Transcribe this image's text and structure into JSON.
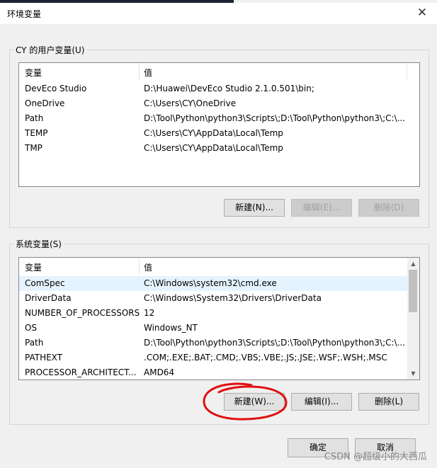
{
  "window": {
    "title": "环境变量",
    "close_glyph": "✕"
  },
  "user_vars": {
    "group_title": "CY 的用户变量(U)",
    "columns": [
      "变量",
      "值"
    ],
    "rows": [
      {
        "name": "DevEco Studio",
        "value": "D:\\Huawei\\DevEco Studio 2.1.0.501\\bin;"
      },
      {
        "name": "OneDrive",
        "value": "C:\\Users\\CY\\OneDrive"
      },
      {
        "name": "Path",
        "value": "D:\\Tool\\Python\\python3\\Scripts\\;D:\\Tool\\Python\\python3\\;C:\\..."
      },
      {
        "name": "TEMP",
        "value": "C:\\Users\\CY\\AppData\\Local\\Temp"
      },
      {
        "name": "TMP",
        "value": "C:\\Users\\CY\\AppData\\Local\\Temp"
      }
    ],
    "buttons": {
      "new": "新建(N)...",
      "edit": "编辑(E)...",
      "delete": "删除(D)"
    }
  },
  "system_vars": {
    "group_title": "系统变量(S)",
    "columns": [
      "变量",
      "值"
    ],
    "rows": [
      {
        "name": "ComSpec",
        "value": "C:\\Windows\\system32\\cmd.exe"
      },
      {
        "name": "DriverData",
        "value": "C:\\Windows\\System32\\Drivers\\DriverData"
      },
      {
        "name": "NUMBER_OF_PROCESSORS",
        "value": "12"
      },
      {
        "name": "OS",
        "value": "Windows_NT"
      },
      {
        "name": "Path",
        "value": "D:\\Tool\\Python\\python3\\Scripts\\;D:\\Tool\\Python\\python3\\;C:\\..."
      },
      {
        "name": "PATHEXT",
        "value": ".COM;.EXE;.BAT;.CMD;.VBS;.VBE;.JS;.JSE;.WSF;.WSH;.MSC"
      },
      {
        "name": "PROCESSOR_ARCHITECT...",
        "value": "AMD64"
      }
    ],
    "buttons": {
      "new": "新建(W)...",
      "edit": "编辑(I)...",
      "delete": "删除(L)"
    }
  },
  "footer": {
    "ok": "确定",
    "cancel": "取消"
  },
  "watermark": "CSDN @超级小的大西瓜",
  "colors": {
    "annotation_circle": "#e01010",
    "selection": "#e5f3ff"
  }
}
